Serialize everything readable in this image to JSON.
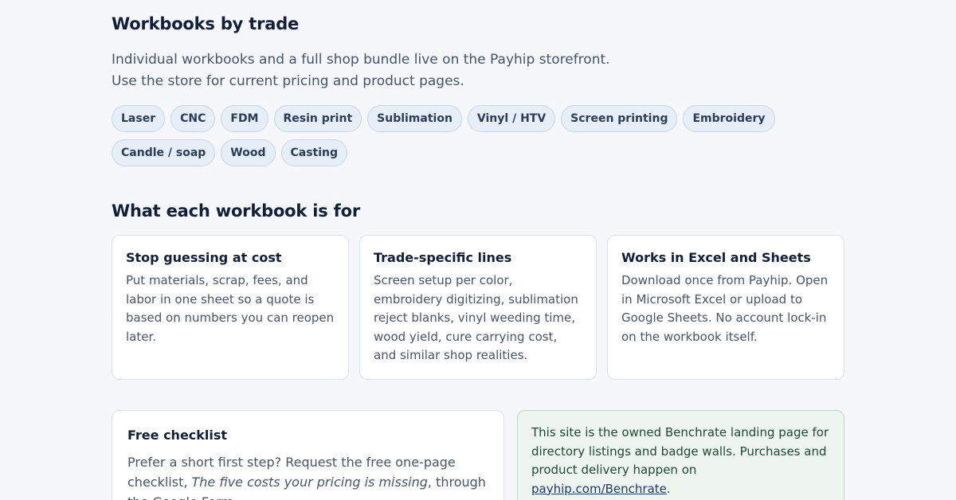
{
  "workbooks": {
    "title": "Workbooks by trade",
    "lead": "Individual workbooks and a full shop bundle live on the Payhip storefront. Use the store for current pricing and product pages.",
    "trades": [
      "Laser",
      "CNC",
      "FDM",
      "Resin print",
      "Sublimation",
      "Vinyl / HTV",
      "Screen printing",
      "Embroidery",
      "Candle / soap",
      "Wood",
      "Casting"
    ]
  },
  "purpose": {
    "title": "What each workbook is for",
    "cards": [
      {
        "title": "Stop guessing at cost",
        "body": "Put materials, scrap, fees, and labor in one sheet so a quote is based on numbers you can reopen later."
      },
      {
        "title": "Trade-specific lines",
        "body": "Screen setup per color, embroidery digitizing, sublimation reject blanks, vinyl weeding time, wood yield, cure carrying cost, and similar shop realities."
      },
      {
        "title": "Works in Excel and Sheets",
        "body": "Download once from Payhip. Open in Microsoft Excel or upload to Google Sheets. No account lock-in on the workbook itself."
      }
    ]
  },
  "checklist": {
    "title": "Free checklist",
    "body_before": "Prefer a short first step? Request the free one-page checklist, ",
    "body_italic": "The five costs your pricing is missing",
    "body_after": ", through the Google Form."
  },
  "note": {
    "text_before": "This site is the owned Benchrate landing page for directory listings and badge walls. Purchases and product delivery happen on ",
    "link_label": "payhip.com/Benchrate",
    "text_after": "."
  }
}
